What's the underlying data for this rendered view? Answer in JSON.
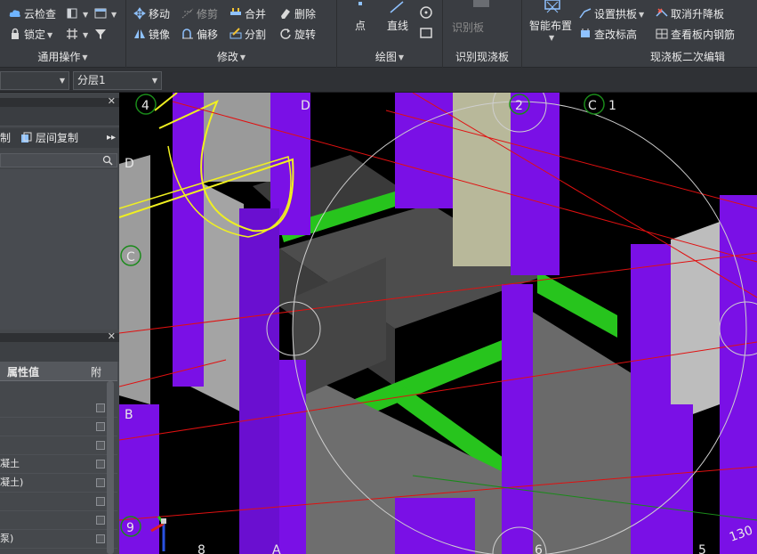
{
  "ribbon": {
    "general": {
      "title": "通用操作",
      "cloud_check": "云检查",
      "lock": "锁定"
    },
    "modify": {
      "title": "修改",
      "move": "移动",
      "trim": "修剪",
      "merge": "合并",
      "delete": "删除",
      "mirror": "镜像",
      "offset": "偏移",
      "split": "分割",
      "rotate": "旋转"
    },
    "draw": {
      "title": "绘图",
      "point": "点",
      "line": "直线"
    },
    "identify": {
      "title": "识别现浇板",
      "identify_slab": "识别板"
    },
    "secondary": {
      "title": "现浇板二次编辑",
      "smart_layout": "智能布置",
      "set_arch": "设置拱板",
      "cancel_drop": "取消升降板",
      "check_elevation": "查改标高",
      "view_rebar": "查看板内钢筋"
    }
  },
  "toolbar": {
    "combo1_value": "",
    "layer_value": "分层1"
  },
  "panel_top": {
    "tab_left": "制",
    "tab_copy": "层间复制"
  },
  "panel_props": {
    "col_value": "属性值",
    "col_attach": "附",
    "rows": [
      "",
      "",
      "",
      "凝土",
      "凝土)",
      "",
      "",
      "泵)"
    ]
  },
  "viewport": {
    "axis_labels": [
      "4",
      "D",
      "2",
      "C",
      "1",
      "D",
      "C",
      "B",
      "9",
      "8",
      "A",
      "6",
      "5"
    ],
    "coord_text": "130"
  },
  "colors": {
    "column": "#7a10e6",
    "beam": "#27c41d",
    "wall": "#8e8e8e",
    "slab": "#505050",
    "axis_line": "#e01010"
  }
}
